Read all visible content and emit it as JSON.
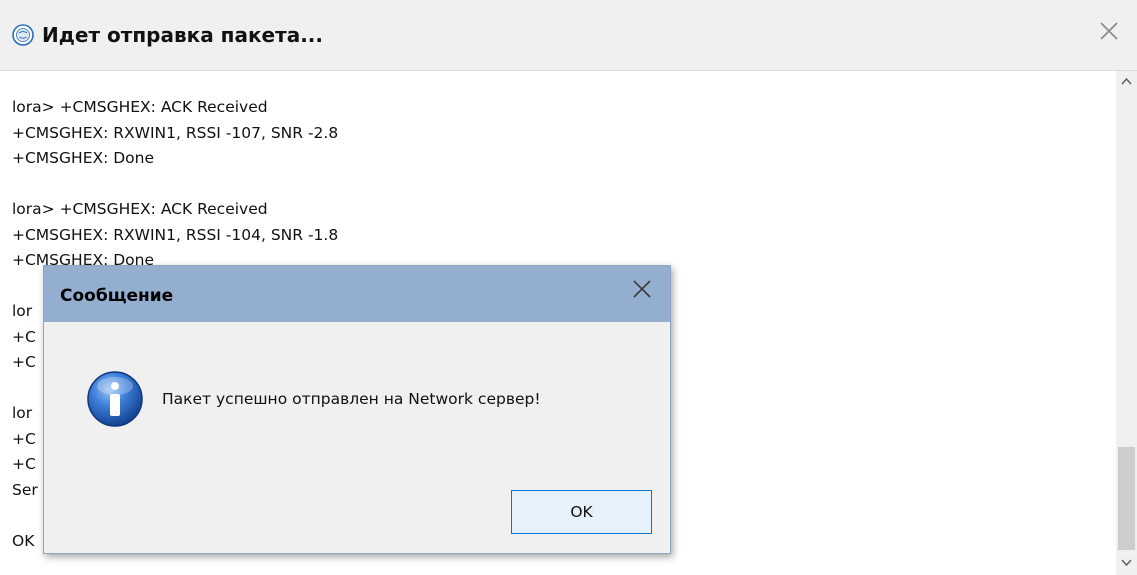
{
  "window": {
    "title": "Идет отправка пакета...",
    "icons": {
      "app": "app-logo-icon",
      "close": "close-icon"
    }
  },
  "log": {
    "lines": [
      "lora> +CMSGHEX: ACK Received",
      "+CMSGHEX: RXWIN1, RSSI -107, SNR -2.8",
      "+CMSGHEX: Done",
      "",
      "lora> +CMSGHEX: ACK Received",
      "+CMSGHEX: RXWIN1, RSSI -104, SNR -1.8",
      "+CMSGHEX: Done",
      "",
      "lor",
      "+C",
      "+C",
      "",
      "lor",
      "+C",
      "+C",
      "Ser",
      "",
      "OK"
    ]
  },
  "scrollbar": {
    "icons": {
      "up": "chevron-up-icon",
      "down": "chevron-down-icon"
    }
  },
  "dialog": {
    "title": "Сообщение",
    "message": "Пакет успешно отправлен на Network сервер!",
    "ok_label": "OK",
    "icons": {
      "info": "info-icon",
      "close": "close-icon"
    }
  },
  "colors": {
    "dialog_titlebar": "#94aed0",
    "ok_button_border": "#0078d7",
    "ok_button_fill": "#e5f1fb",
    "info_icon_blue": "#1f5fc0"
  }
}
